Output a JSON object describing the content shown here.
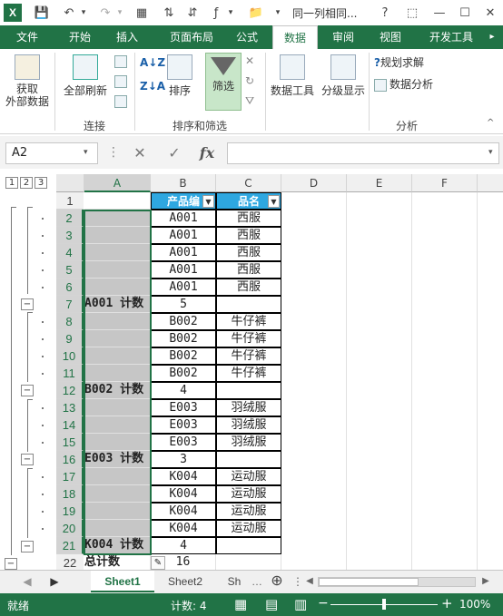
{
  "titlebar": {
    "app_logo": "X",
    "title": "同一列相同...",
    "help": "?",
    "icons": [
      "save-icon",
      "undo-icon",
      "redo-icon",
      "table-icon",
      "sort-asc-icon",
      "sort-desc-icon",
      "insert-function-icon",
      "folder-icon",
      "customize-qat-icon"
    ]
  },
  "tabs": [
    "文件",
    "开始",
    "插入",
    "页面布局",
    "公式",
    "数据",
    "审阅",
    "视图",
    "开发工具"
  ],
  "active_tab": "数据",
  "ribbon": {
    "get_external": "获取\n外部数据",
    "refresh_all": "全部刷新",
    "sort": "排序",
    "filter": "筛选",
    "data_tools": "数据工具",
    "outline": "分级显示",
    "solver": "规划求解",
    "analysis": "数据分析",
    "group_connections": "连接",
    "group_sort_filter": "排序和筛选",
    "group_analysis": "分析"
  },
  "formula_bar": {
    "name_box": "A2",
    "formula": "",
    "fx": "fx"
  },
  "columns": [
    "A",
    "B",
    "C",
    "D",
    "E",
    "F"
  ],
  "outline_levels": [
    "1",
    "2",
    "3"
  ],
  "headers": {
    "b": "产品编",
    "c": "品名"
  },
  "rows": [
    {
      "n": "1",
      "a": "",
      "b": "",
      "c": ""
    },
    {
      "n": "2",
      "a": "",
      "b": "A001",
      "c": "西服"
    },
    {
      "n": "3",
      "a": "",
      "b": "A001",
      "c": "西服"
    },
    {
      "n": "4",
      "a": "",
      "b": "A001",
      "c": "西服"
    },
    {
      "n": "5",
      "a": "",
      "b": "A001",
      "c": "西服"
    },
    {
      "n": "6",
      "a": "",
      "b": "A001",
      "c": "西服"
    },
    {
      "n": "7",
      "a": "A001 计数",
      "b": "5",
      "c": ""
    },
    {
      "n": "8",
      "a": "",
      "b": "B002",
      "c": "牛仔裤"
    },
    {
      "n": "9",
      "a": "",
      "b": "B002",
      "c": "牛仔裤"
    },
    {
      "n": "10",
      "a": "",
      "b": "B002",
      "c": "牛仔裤"
    },
    {
      "n": "11",
      "a": "",
      "b": "B002",
      "c": "牛仔裤"
    },
    {
      "n": "12",
      "a": "B002 计数",
      "b": "4",
      "c": ""
    },
    {
      "n": "13",
      "a": "",
      "b": "E003",
      "c": "羽绒服"
    },
    {
      "n": "14",
      "a": "",
      "b": "E003",
      "c": "羽绒服"
    },
    {
      "n": "15",
      "a": "",
      "b": "E003",
      "c": "羽绒服"
    },
    {
      "n": "16",
      "a": "E003 计数",
      "b": "3",
      "c": ""
    },
    {
      "n": "17",
      "a": "",
      "b": "K004",
      "c": "运动服"
    },
    {
      "n": "18",
      "a": "",
      "b": "K004",
      "c": "运动服"
    },
    {
      "n": "19",
      "a": "",
      "b": "K004",
      "c": "运动服"
    },
    {
      "n": "20",
      "a": "",
      "b": "K004",
      "c": "运动服"
    },
    {
      "n": "21",
      "a": "K004 计数",
      "b": "4",
      "c": ""
    },
    {
      "n": "22",
      "a": "总计数",
      "b": "16",
      "c": ""
    }
  ],
  "sheets": [
    "Sheet1",
    "Sheet2",
    "Sh"
  ],
  "active_sheet": "Sheet1",
  "status": {
    "ready": "就绪",
    "count": "计数: 4",
    "zoom": "100%",
    "minus": "−",
    "plus": "+"
  },
  "colors": {
    "accent": "#217346",
    "header_fill": "#2ea7e0",
    "selection": "#c6c6c6"
  }
}
